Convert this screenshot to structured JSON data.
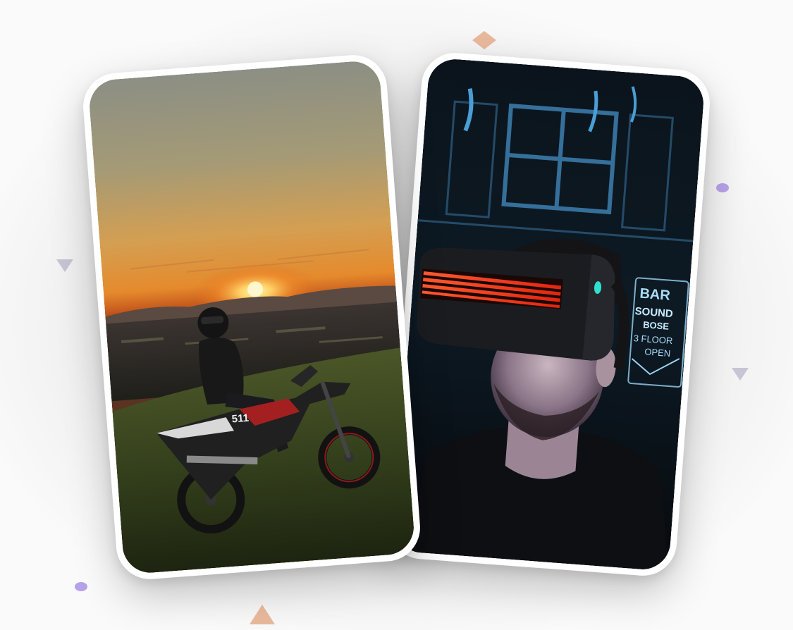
{
  "accent_colors": {
    "peach": "#e9b99c",
    "lavender_triangle": "#c9c4d3",
    "purple_dot": "#b6a2e8"
  },
  "photos": [
    {
      "id": "sunset-motorbike",
      "plate_text": "511",
      "sky_top": "#8c8f84",
      "sky_mid": "#e49a3a",
      "sun": "#fff5b0"
    },
    {
      "id": "vr-headset",
      "sign_line1": "BAR",
      "sign_line2": "SOUND",
      "sign_line3": "BOSE",
      "sign_line4": "3 FLOOR",
      "sign_line5": "OPEN",
      "glow": "#ff3a1e",
      "neon": "#3d7fb0"
    }
  ]
}
